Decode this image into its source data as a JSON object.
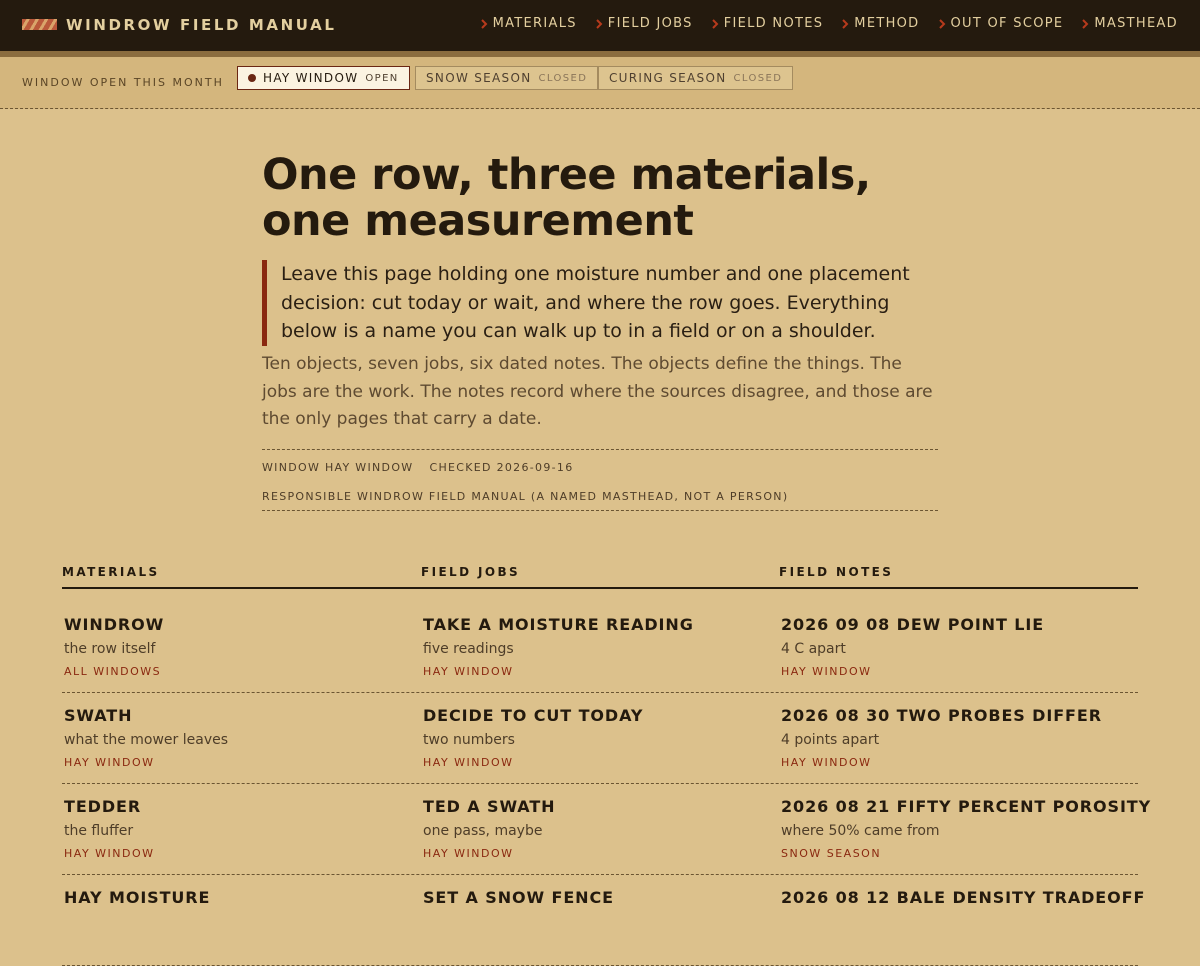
{
  "header": {
    "brand": "WINDROW FIELD MANUAL",
    "nav": [
      "MATERIALS",
      "FIELD JOBS",
      "FIELD NOTES",
      "METHOD",
      "OUT OF SCOPE",
      "MASTHEAD"
    ]
  },
  "window_bar": {
    "label": "WINDOW OPEN THIS MONTH",
    "pills": [
      {
        "name": "HAY WINDOW",
        "state": "OPEN"
      },
      {
        "name": "SNOW SEASON",
        "state": "CLOSED"
      },
      {
        "name": "CURING SEASON",
        "state": "CLOSED"
      }
    ]
  },
  "hero": {
    "title": "One row, three materials, one measurement",
    "lede": "Leave this page holding one moisture number and one placement decision: cut today or wait, and where the row goes. Everything below is a name you can walk up to in a field or on a shoulder.",
    "sub": "Ten objects, seven jobs, six dated notes. The objects define the things. The jobs are the work. The notes record where the sources disagree, and those are the only pages that carry a date.",
    "meta_window": "WINDOW HAY WINDOW",
    "meta_checked": "CHECKED 2026-09-16",
    "meta_responsible": "RESPONSIBLE WINDROW FIELD MANUAL (A NAMED MASTHEAD, NOT A PERSON)"
  },
  "columns": {
    "materials_header": "MATERIALS",
    "jobs_header": "FIELD JOBS",
    "notes_header": "FIELD NOTES",
    "materials": [
      {
        "title": "WINDROW",
        "desc": "the row itself",
        "window": "ALL WINDOWS"
      },
      {
        "title": "SWATH",
        "desc": "what the mower leaves",
        "window": "HAY WINDOW"
      },
      {
        "title": "TEDDER",
        "desc": "the fluffer",
        "window": "HAY WINDOW"
      },
      {
        "title": "HAY MOISTURE",
        "desc": "",
        "window": ""
      }
    ],
    "jobs": [
      {
        "title": "TAKE A MOISTURE READING",
        "desc": "five readings",
        "window": "HAY WINDOW"
      },
      {
        "title": "DECIDE TO CUT TODAY",
        "desc": "two numbers",
        "window": "HAY WINDOW"
      },
      {
        "title": "TED A SWATH",
        "desc": "one pass, maybe",
        "window": "HAY WINDOW"
      },
      {
        "title": "SET A SNOW FENCE",
        "desc": "",
        "window": ""
      }
    ],
    "notes": [
      {
        "title": "2026 09 08 DEW POINT LIE",
        "desc": "4 C apart",
        "window": "HAY WINDOW"
      },
      {
        "title": "2026 08 30 TWO PROBES DIFFER",
        "desc": "4 points apart",
        "window": "HAY WINDOW"
      },
      {
        "title": "2026 08 21 FIFTY PERCENT POROSITY",
        "desc": "where 50% came from",
        "window": "SNOW SEASON"
      },
      {
        "title": "2026 08 12 BALE DENSITY TRADEOFF",
        "desc": "",
        "window": ""
      }
    ]
  },
  "colors": {
    "background": "#dcc18c",
    "topbar": "#241a0e",
    "accent": "#8a2810",
    "text": "#241a0e"
  }
}
